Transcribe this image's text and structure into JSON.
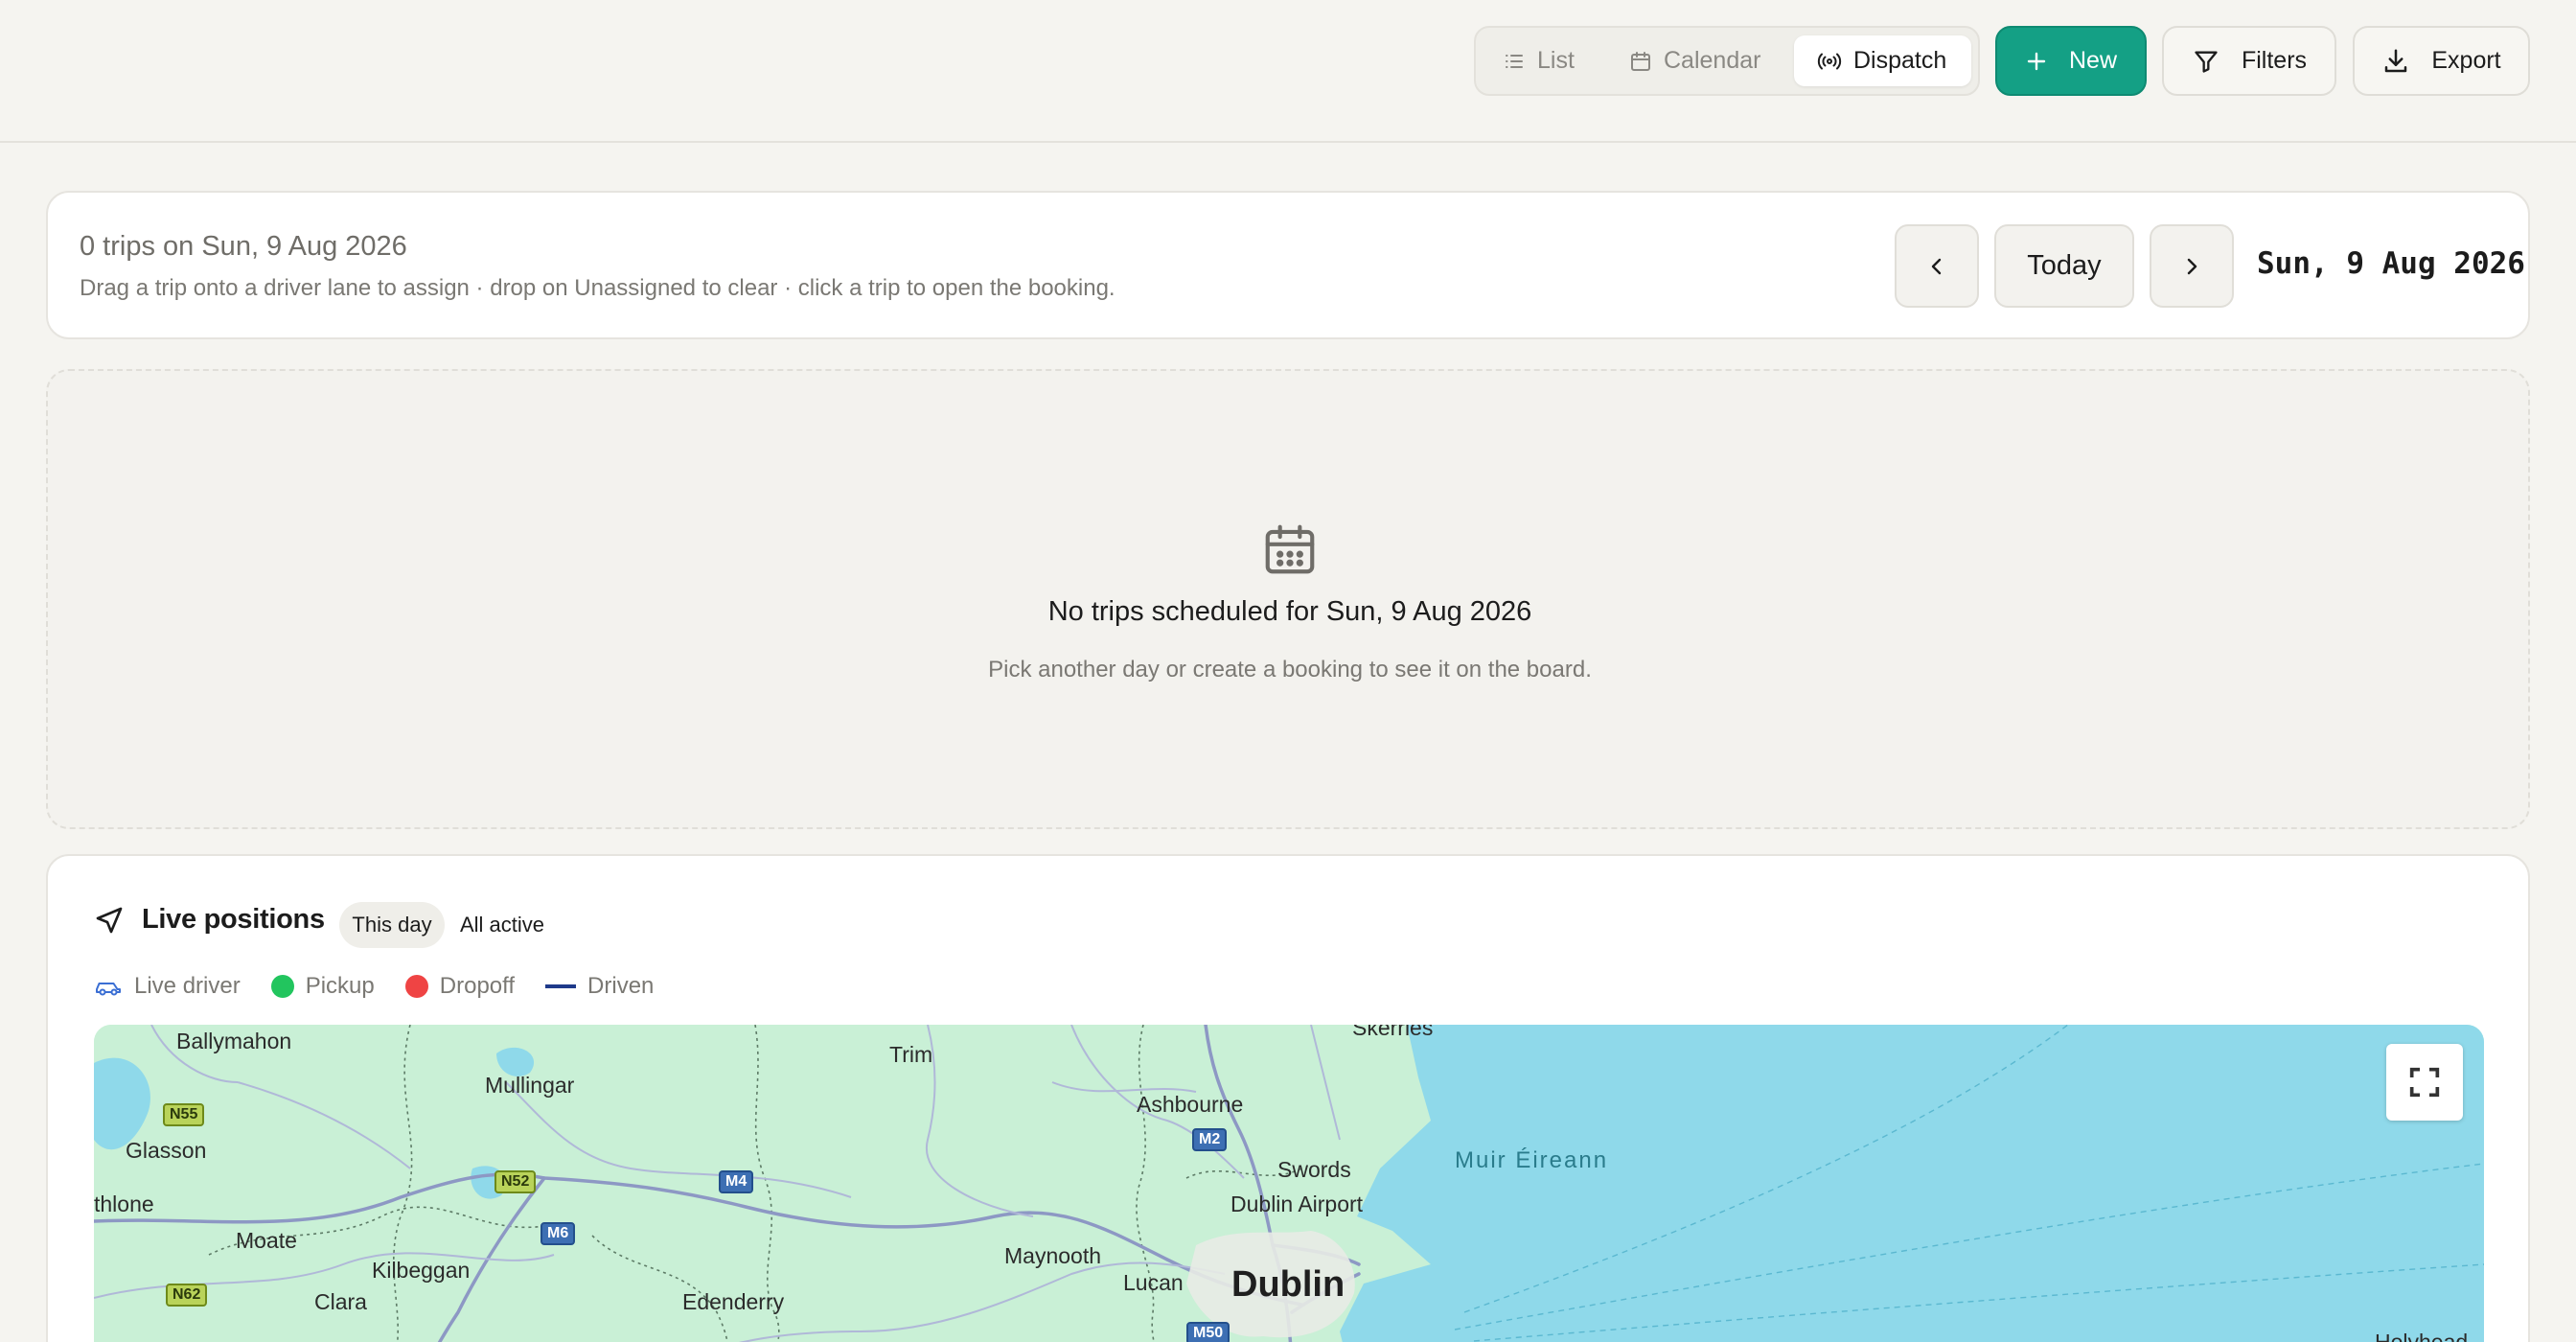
{
  "toolbar": {
    "views": [
      {
        "label": "List",
        "icon": "list-icon",
        "active": false
      },
      {
        "label": "Calendar",
        "icon": "calendar-icon",
        "active": false
      },
      {
        "label": "Dispatch",
        "icon": "broadcast-icon",
        "active": true
      }
    ],
    "new_label": "New",
    "filters_label": "Filters",
    "export_label": "Export",
    "accent_color": "#14a085"
  },
  "summary": {
    "title": "0 trips on Sun, 9 Aug 2026",
    "hint": "Drag a trip onto a driver lane to assign · drop on Unassigned to clear · click a trip to open the booking.",
    "today_label": "Today",
    "date": "Sun, 9 Aug 2026"
  },
  "board": {
    "empty_title": "No trips scheduled for Sun, 9 Aug 2026",
    "empty_subtitle": "Pick another day or create a booking to see it on the board."
  },
  "live": {
    "title": "Live positions",
    "filters": [
      {
        "label": "This day",
        "active": true
      },
      {
        "label": "All active",
        "active": false
      }
    ],
    "legend": [
      {
        "label": "Live driver",
        "icon": "car-icon",
        "color": "#3b6fd4"
      },
      {
        "label": "Pickup",
        "icon": "dot",
        "color": "#22c55e"
      },
      {
        "label": "Dropoff",
        "icon": "dot",
        "color": "#ef4444"
      },
      {
        "label": "Driven",
        "icon": "line",
        "color": "#1e3a8a"
      }
    ]
  },
  "map": {
    "places": {
      "ballymahon": "Ballymahon",
      "mullingar": "Mullingar",
      "trim": "Trim",
      "ashbourne": "Ashbourne",
      "skerries": "Skerries",
      "glasson": "Glasson",
      "athlone": "thlone",
      "swords": "Swords",
      "dublin_airport": "Dublin Airport",
      "moate": "Moate",
      "kilbeggan": "Kilbeggan",
      "maynooth": "Maynooth",
      "lucan": "Lucan",
      "dublin": "Dublin",
      "clara": "Clara",
      "edenderry": "Edenderry",
      "holyhead": "Holyhead",
      "sea": "Muir Éireann"
    },
    "roads": {
      "n55": "N55",
      "n52": "N52",
      "m4": "M4",
      "m6": "M6",
      "m2": "M2",
      "n62": "N62",
      "m50": "M50"
    }
  }
}
